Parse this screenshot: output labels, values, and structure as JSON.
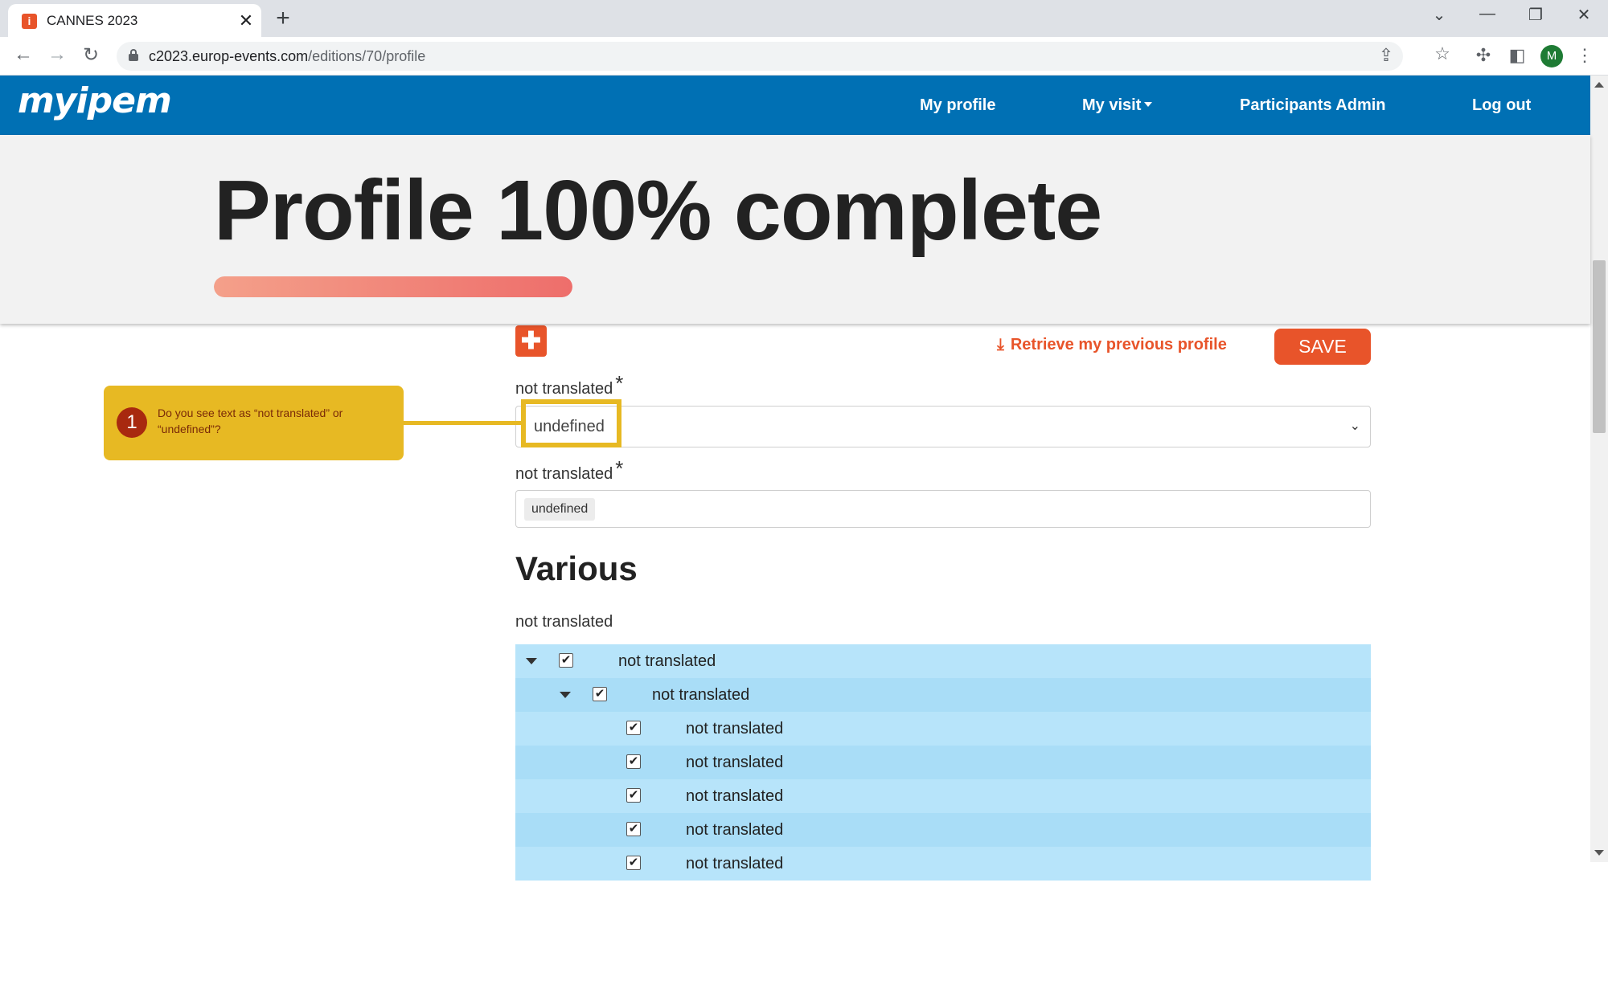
{
  "browser": {
    "tab_title": "CANNES 2023",
    "favicon_glyph": "i",
    "close_glyph": "✕",
    "new_tab_glyph": "+",
    "url_host": "c2023.europ-events.com",
    "url_path": "/editions/70/profile",
    "profile_initial": "M",
    "icons": {
      "back": "←",
      "forward": "→",
      "reload": "↻",
      "share": "⇪",
      "star": "☆",
      "extensions": "✣",
      "sidepanel": "◧",
      "menu": "⋮",
      "tab_search": "⌄",
      "minimize": "—",
      "restore": "❐",
      "close_window": "✕"
    }
  },
  "site_nav": {
    "logo": "myipem",
    "items": [
      {
        "label": "My profile"
      },
      {
        "label": "My visit"
      },
      {
        "label": "Participants Admin"
      },
      {
        "label": "Log out"
      }
    ]
  },
  "banner": {
    "title": "Profile 100% complete",
    "progress": 1.0
  },
  "toolbar": {
    "add_glyph": "✚",
    "download_glyph": "⤓",
    "retrieve_label": "Retrieve my previous profile",
    "save_label": "SAVE"
  },
  "form": {
    "field1_label": "not translated",
    "required_mark": "*",
    "field1_value": "undefined",
    "chevron_glyph": "⌄",
    "field2_label": "not translated",
    "field2_tag": "undefined"
  },
  "various": {
    "heading": "Various",
    "subtitle": "not translated",
    "check_glyph": "✔",
    "rows": [
      {
        "label": "not translated",
        "level": 0,
        "expandable": true,
        "checked": true
      },
      {
        "label": "not translated",
        "level": 1,
        "expandable": true,
        "checked": true
      },
      {
        "label": "not translated",
        "level": 2,
        "expandable": false,
        "checked": true
      },
      {
        "label": "not translated",
        "level": 2,
        "expandable": false,
        "checked": true
      },
      {
        "label": "not translated",
        "level": 2,
        "expandable": false,
        "checked": true
      },
      {
        "label": "not translated",
        "level": 2,
        "expandable": false,
        "checked": true
      },
      {
        "label": "not translated",
        "level": 2,
        "expandable": false,
        "checked": true
      }
    ]
  },
  "callout": {
    "step": "1",
    "text": "Do you see text as “not translated” or “undefined”?"
  },
  "colors": {
    "nav_blue": "#0070b4",
    "accent_orange": "#e8542a",
    "callout_yellow": "#e7b923",
    "tree_blue": "#b7e4fa"
  }
}
